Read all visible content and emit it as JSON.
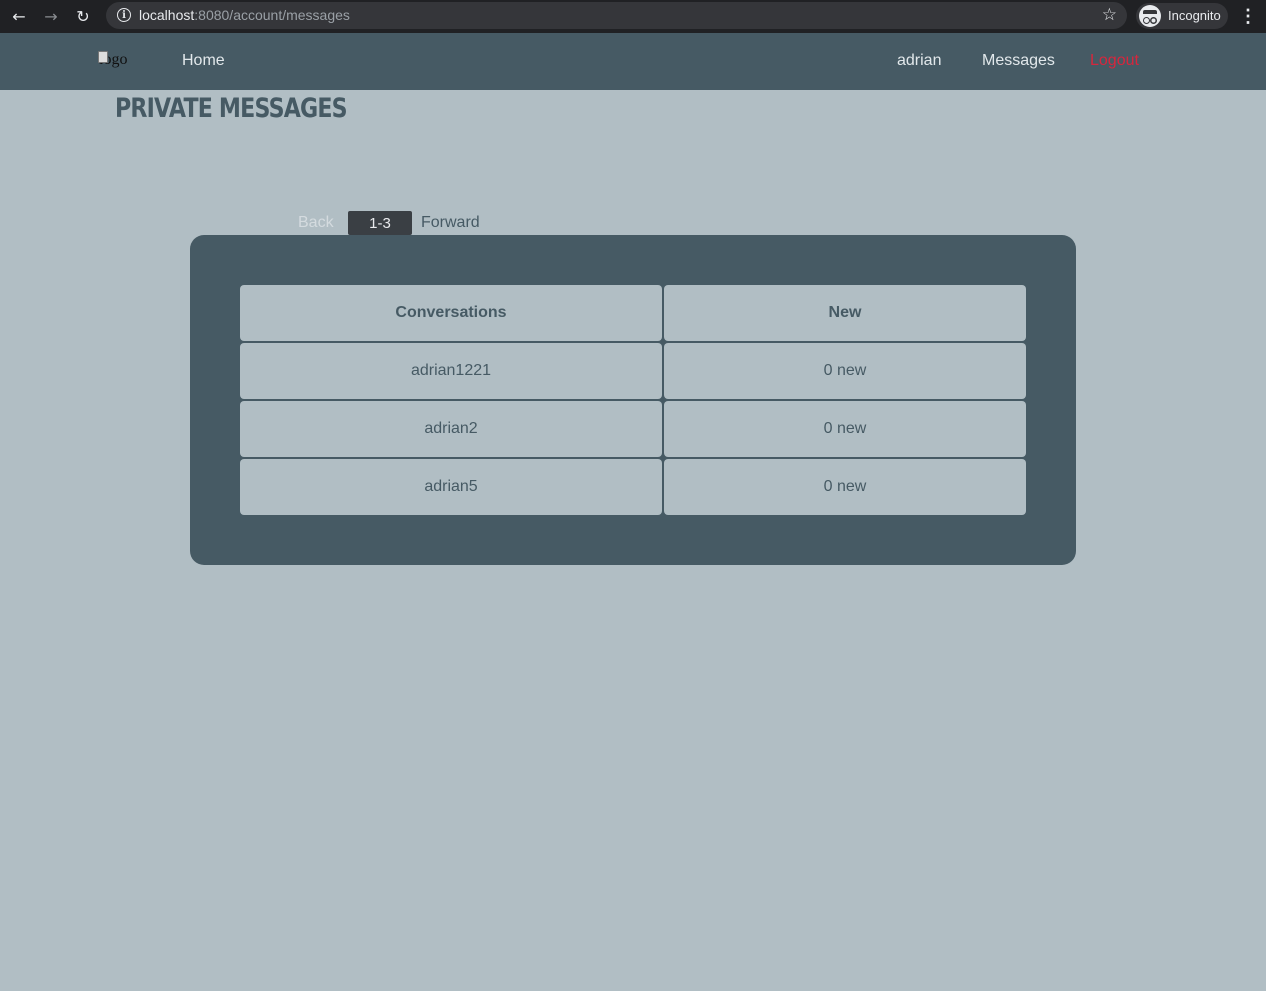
{
  "browser": {
    "url_host": "localhost",
    "url_rest": ":8080/account/messages",
    "incognito_label": "Incognito"
  },
  "nav": {
    "logo_alt": "logo",
    "home": "Home",
    "user": "adrian",
    "messages": "Messages",
    "logout": "Logout"
  },
  "page_title": "Private Messages",
  "pager": {
    "back": "Back",
    "range": "1-3",
    "forward": "Forward"
  },
  "table": {
    "headers": [
      "Conversations",
      "New"
    ],
    "rows": [
      [
        "adrian1221",
        "0 new"
      ],
      [
        "adrian2",
        "0 new"
      ],
      [
        "adrian5",
        "0 new"
      ]
    ]
  }
}
